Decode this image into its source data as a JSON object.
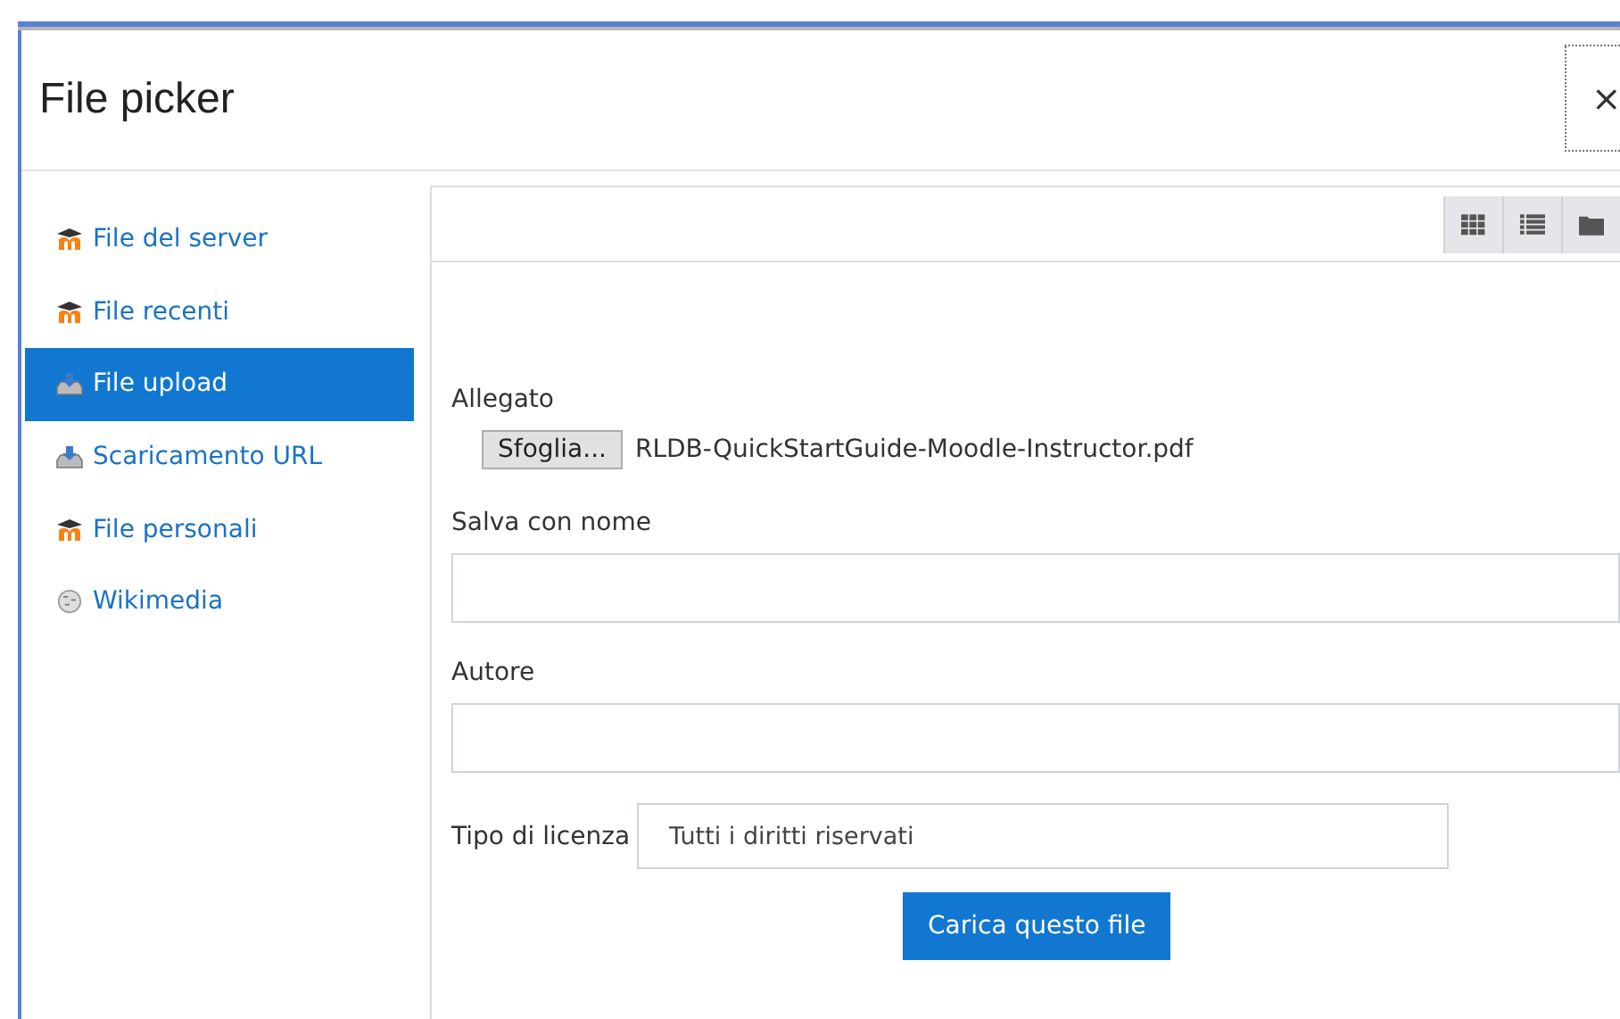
{
  "dialog": {
    "title": "File picker",
    "close": "×"
  },
  "sidebar": {
    "items": [
      {
        "label": "File del server",
        "kind": "moodle",
        "selected": false
      },
      {
        "label": "File recenti",
        "kind": "moodle",
        "selected": false
      },
      {
        "label": "File upload",
        "kind": "upload",
        "selected": true
      },
      {
        "label": "Scaricamento URL",
        "kind": "upload",
        "selected": false
      },
      {
        "label": "File personali",
        "kind": "moodle",
        "selected": false
      },
      {
        "label": "Wikimedia",
        "kind": "wiki",
        "selected": false
      }
    ]
  },
  "toolbar": {
    "views": [
      {
        "kind": "grid",
        "selected": false
      },
      {
        "kind": "list",
        "selected": false
      },
      {
        "kind": "folder",
        "selected": false
      }
    ]
  },
  "form": {
    "attachment_label": "Allegato",
    "browse_button": "Sfoglia...",
    "file_name": "RLDB-QuickStartGuide-Moodle-Instructor.pdf",
    "save_as_label": "Salva con nome",
    "author_label": "Autore",
    "license_label": "Tipo di licenza",
    "license_value": "Tutti i diritti riservati",
    "submit": "Carica questo file"
  }
}
